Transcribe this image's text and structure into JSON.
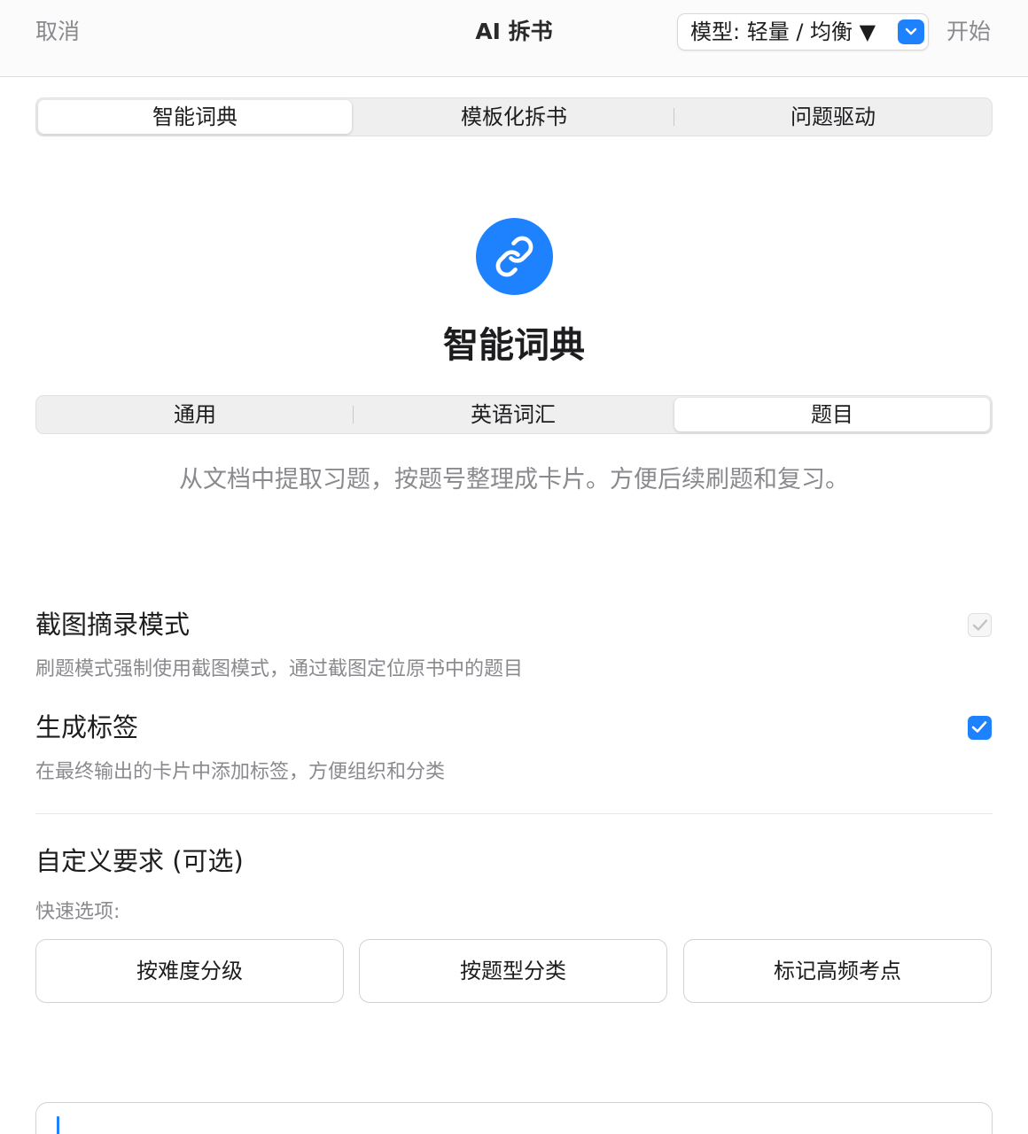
{
  "header": {
    "cancel_label": "取消",
    "title": "AI 拆书",
    "model_label": "模型: 轻量 / 均衡 ▼",
    "start_label": "开始"
  },
  "mode_tabs": [
    {
      "label": "智能词典",
      "active": true
    },
    {
      "label": "模板化拆书",
      "active": false
    },
    {
      "label": "问题驱动",
      "active": false
    }
  ],
  "hero": {
    "icon": "link-icon",
    "title": "智能词典"
  },
  "sub_tabs": [
    {
      "label": "通用",
      "active": false
    },
    {
      "label": "英语词汇",
      "active": false
    },
    {
      "label": "题目",
      "active": true
    }
  ],
  "description": "从文档中提取习题，按题号整理成卡片。方便后续刷题和复习。",
  "options": [
    {
      "title": "截图摘录模式",
      "desc": "刷题模式强制使用截图模式，通过截图定位原书中的题目",
      "checked": true,
      "disabled": true
    },
    {
      "title": "生成标签",
      "desc": "在最终输出的卡片中添加标签，方便组织和分类",
      "checked": true,
      "disabled": false
    }
  ],
  "custom": {
    "title": "自定义要求 (可选)",
    "quick_label": "快速选项:",
    "quick_options": [
      "按难度分级",
      "按题型分类",
      "标记高频考点"
    ],
    "input_value": ""
  },
  "colors": {
    "accent": "#1e82ff",
    "secondary_text": "#8a8a8e"
  }
}
